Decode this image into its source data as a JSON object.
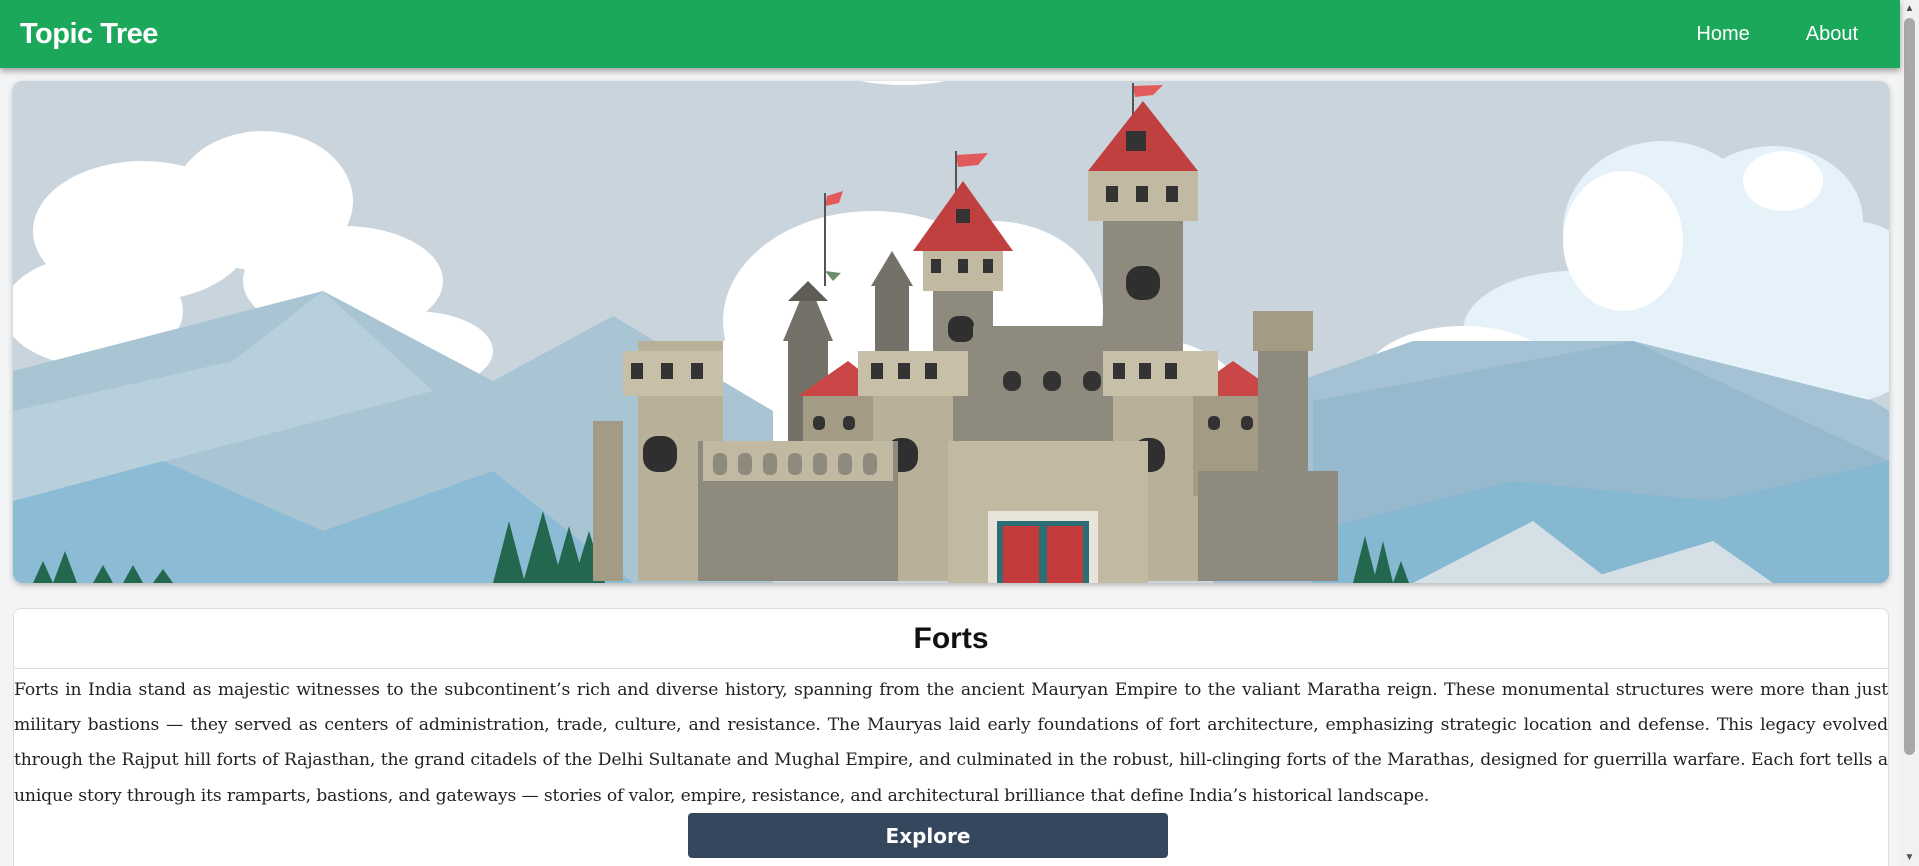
{
  "navbar": {
    "brand": "Topic Tree",
    "links": [
      {
        "label": "Home"
      },
      {
        "label": "About"
      }
    ],
    "bg_color": "#1ba85a"
  },
  "hero": {
    "image_subject": "castle-illustration"
  },
  "card": {
    "title": "Forts",
    "description": "Forts in India stand as majestic witnesses to the subcontinent’s rich and diverse history, spanning from the ancient Mauryan Empire to the valiant Maratha reign. These monumental structures were more than just military bastions — they served as centers of administration, trade, culture, and resistance. The Mauryas laid early foundations of fort architecture, emphasizing strategic location and defense. This legacy evolved through the Rajput hill forts of Rajasthan, the grand citadels of the Delhi Sultanate and Mughal Empire, and culminated in the robust, hill-clinging forts of the Marathas, designed for guerrilla warfare. Each fort tells a unique story through its ramparts, bastions, and gateways — stories of valor, empire, resistance, and architectural brilliance that define India’s historical landscape.",
    "button_label": "Explore",
    "button_color": "#34475c"
  },
  "scrollbar": {
    "up_icon": "triangle-up-icon",
    "down_icon": "triangle-down-icon"
  }
}
